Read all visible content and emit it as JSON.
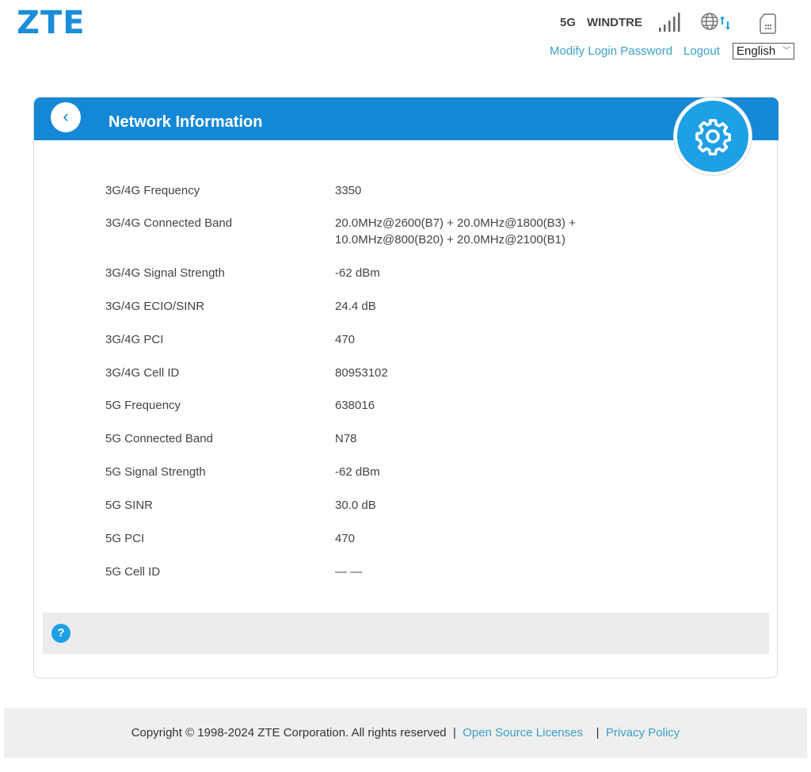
{
  "header": {
    "logo": "ZTE",
    "network_type": "5G",
    "operator": "WINDTRE",
    "modify_password": "Modify Login Password",
    "logout": "Logout",
    "language": "English"
  },
  "page": {
    "title": "Network Information"
  },
  "rows": [
    {
      "label": "3G/4G Frequency",
      "value": "3350"
    },
    {
      "label": "3G/4G Connected Band",
      "value": "20.0MHz@2600(B7) + 20.0MHz@1800(B3) + 10.0MHz@800(B20) + 20.0MHz@2100(B1)"
    },
    {
      "label": "3G/4G Signal Strength",
      "value": "-62 dBm"
    },
    {
      "label": "3G/4G ECIO/SINR",
      "value": "24.4 dB"
    },
    {
      "label": "3G/4G PCI",
      "value": "470"
    },
    {
      "label": "3G/4G Cell ID",
      "value": "80953102"
    },
    {
      "label": "5G Frequency",
      "value": "638016"
    },
    {
      "label": "5G Connected Band",
      "value": "N78"
    },
    {
      "label": "5G Signal Strength",
      "value": "-62 dBm"
    },
    {
      "label": "5G SINR",
      "value": "30.0 dB"
    },
    {
      "label": "5G PCI",
      "value": "470"
    },
    {
      "label": "5G Cell ID",
      "value": "— —"
    }
  ],
  "help": {
    "icon_label": "?"
  },
  "footer": {
    "copyright": "Copyright © 1998-2024 ZTE Corporation. All rights reserved",
    "sep": "|",
    "open_source": "Open Source Licenses",
    "privacy": "Privacy Policy"
  }
}
